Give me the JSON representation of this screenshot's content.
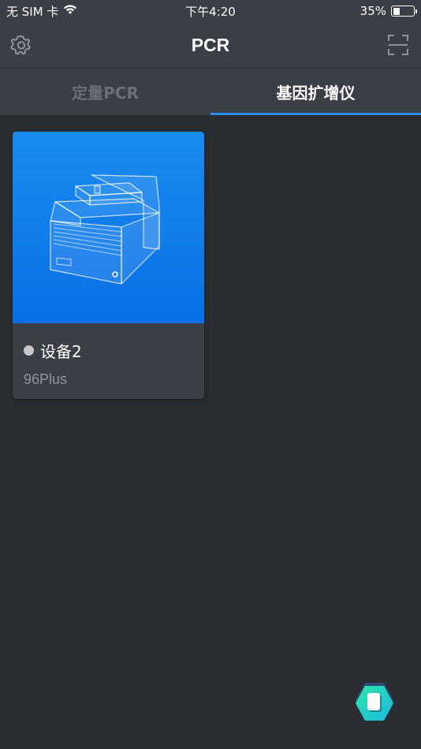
{
  "status_bar": {
    "carrier": "无 SIM 卡",
    "time": "下午4:20",
    "battery_percent": "35%",
    "battery_level": 0.35
  },
  "nav": {
    "title": "PCR",
    "left_icon": "gear-icon",
    "right_icon": "scan-icon"
  },
  "tabs": [
    {
      "label": "定量PCR",
      "active": false
    },
    {
      "label": "基因扩增仪",
      "active": true
    }
  ],
  "devices": [
    {
      "name": "设备2",
      "model": "96Plus",
      "status_color": "#c8c8c8"
    }
  ],
  "colors": {
    "background": "#2a2d31",
    "bar": "#3a3e45",
    "accent": "#2a8cf0",
    "card_gradient_top": "#1a8cf0",
    "card_gradient_bottom": "#0a6fe6",
    "fab_gradient_start": "#2ee6a8",
    "fab_gradient_end": "#1ab8e0"
  }
}
